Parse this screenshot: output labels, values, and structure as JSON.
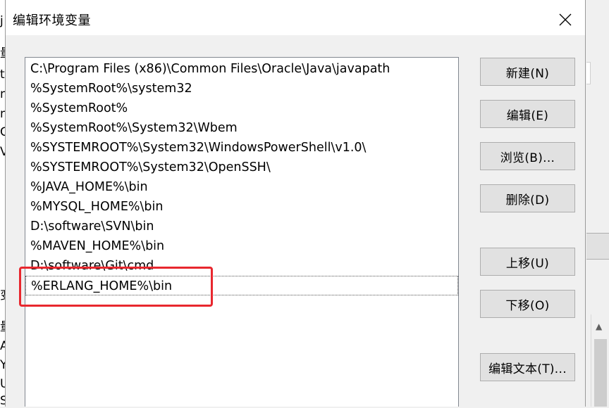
{
  "background": {
    "left_chars": [
      "j",
      "量",
      "t",
      "n",
      "nt",
      "Cl",
      "V",
      "变",
      "量",
      "A",
      "Y",
      "U",
      "S"
    ]
  },
  "dialog": {
    "title": "编辑环境变量",
    "close_icon": "close-icon",
    "paths": [
      "C:\\Program Files (x86)\\Common Files\\Oracle\\Java\\javapath",
      "%SystemRoot%\\system32",
      "%SystemRoot%",
      "%SystemRoot%\\System32\\Wbem",
      "%SYSTEMROOT%\\System32\\WindowsPowerShell\\v1.0\\",
      "%SYSTEMROOT%\\System32\\OpenSSH\\",
      "%JAVA_HOME%\\bin",
      "%MYSQL_HOME%\\bin",
      "D:\\software\\SVN\\bin",
      "%MAVEN_HOME%\\bin",
      "D:\\software\\Git\\cmd",
      "%ERLANG_HOME%\\bin"
    ],
    "selected_index": 11,
    "buttons": {
      "new": "新建(N)",
      "edit": "编辑(E)",
      "browse": "浏览(B)...",
      "delete": "删除(D)",
      "move_up": "上移(U)",
      "move_down": "下移(O)",
      "edit_text": "编辑文本(T)..."
    },
    "highlight_color": "#e8272e"
  }
}
